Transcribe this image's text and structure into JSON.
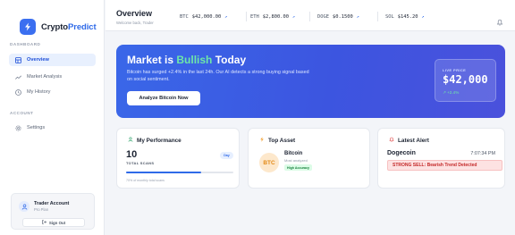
{
  "brand": {
    "name_part1": "Crypto",
    "name_part2": "Predict"
  },
  "sidebar": {
    "dashboard_label": "DASHBOARD",
    "account_label": "ACCOUNT",
    "items": [
      {
        "label": "Overview",
        "icon": "grid-icon",
        "active": true
      },
      {
        "label": "Market Analysis",
        "icon": "trend-icon",
        "active": false
      },
      {
        "label": "My History",
        "icon": "clock-icon",
        "active": false
      }
    ],
    "settings": {
      "label": "Settings",
      "icon": "gear-icon"
    }
  },
  "account": {
    "name": "Trader Account",
    "plan": "Pro Plan",
    "signout_label": "Sign Out"
  },
  "header": {
    "title": "Overview",
    "subtitle": "Welcome back, Trader",
    "tickers": [
      {
        "symbol": "BTC",
        "price": "$42,000.00",
        "arrow": "↗"
      },
      {
        "symbol": "ETH",
        "price": "$2,800.00",
        "arrow": "↗"
      },
      {
        "symbol": "DOGE",
        "price": "$0.1500",
        "arrow": "↗"
      },
      {
        "symbol": "SOL",
        "price": "$145.20",
        "arrow": "↗"
      }
    ]
  },
  "hero": {
    "title_prefix": "Market is ",
    "title_highlight": "Bullish",
    "title_suffix": " Today",
    "description": "Bitcoin has surged +2.4% in the last 24h. Our AI detects a strong buying signal based on social sentiment.",
    "button_label": "Analyze Bitcoin Now",
    "price_label": "LIVE PRICE",
    "price_value": "$42,000",
    "price_change": "↗ +2.4%"
  },
  "performance": {
    "title": "My Performance",
    "count": "10",
    "count_label": "TOTAL SCANS",
    "badge": "Day",
    "progress": 0.7,
    "note": "70% of monthly total scans"
  },
  "top_asset": {
    "title": "Top Asset",
    "coin_symbol": "BTC",
    "coin_name": "Bitcoin",
    "coin_sub": "Most analyzed",
    "badge": "High Accuracy"
  },
  "alert": {
    "title": "Latest Alert",
    "coin": "Dogecoin",
    "time": "7:07:34 PM",
    "message": "STRONG SELL: Bearish Trend Detected"
  },
  "colors": {
    "accent": "#2f6ae8",
    "bullish": "#6ee7a8",
    "alert": "#c42828"
  }
}
